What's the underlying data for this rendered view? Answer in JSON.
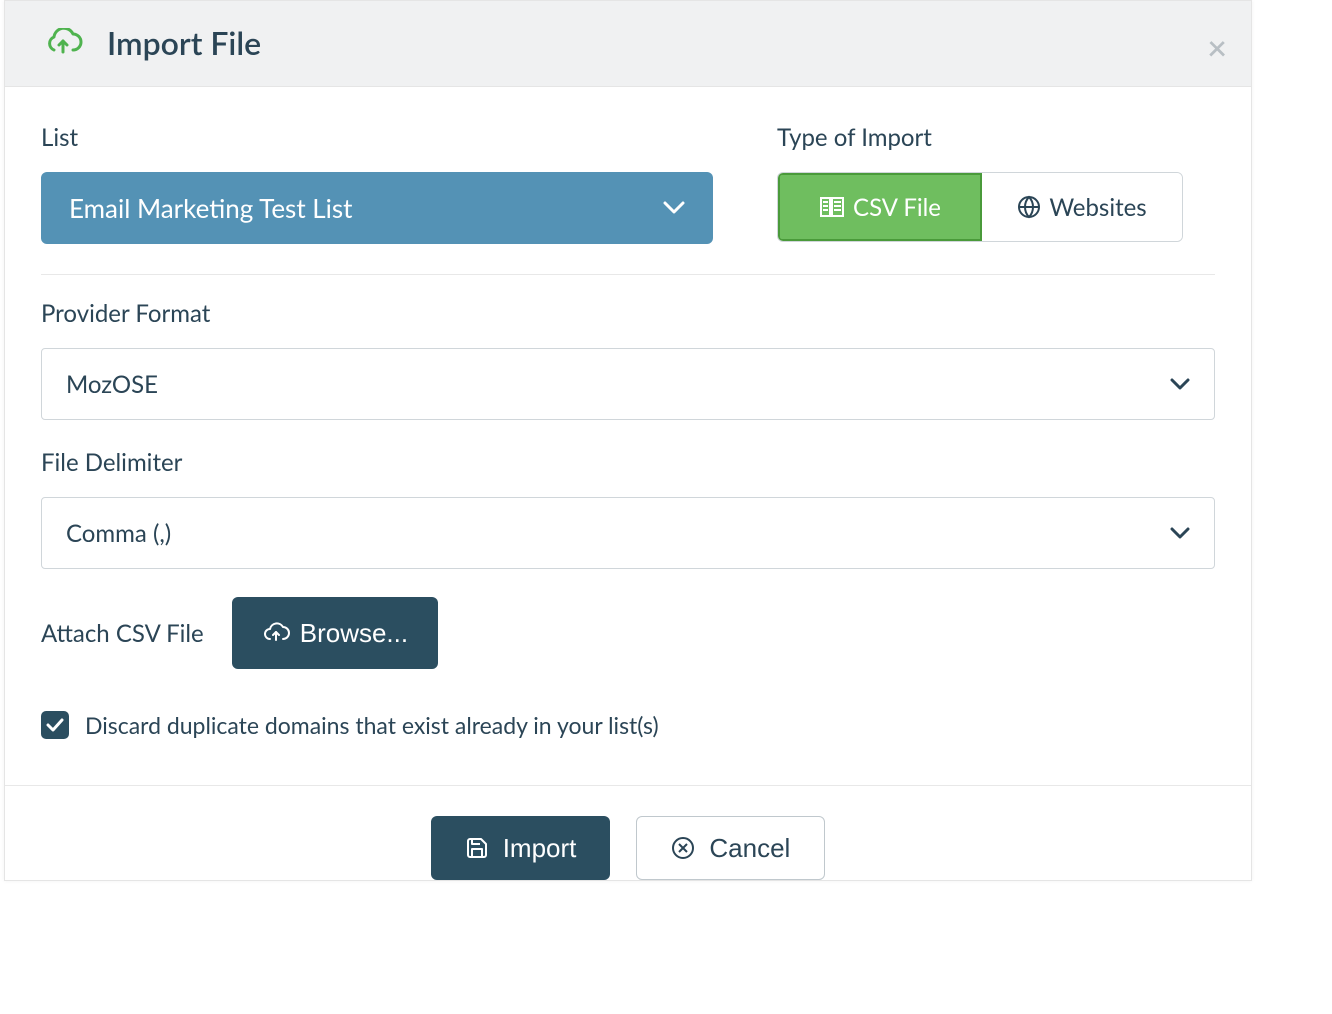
{
  "header": {
    "title": "Import File"
  },
  "labels": {
    "list": "List",
    "type_of_import": "Type of Import",
    "provider_format": "Provider Format",
    "file_delimiter": "File Delimiter",
    "attach_csv": "Attach CSV File",
    "discard_duplicates": "Discard duplicate domains that exist already in your list(s)"
  },
  "values": {
    "list_selected": "Email Marketing Test List",
    "provider_format_selected": "MozOSE",
    "file_delimiter_selected": "Comma (,)"
  },
  "type_toggle": {
    "csv": "CSV File",
    "websites": "Websites"
  },
  "buttons": {
    "browse": "Browse...",
    "import": "Import",
    "cancel": "Cancel"
  }
}
